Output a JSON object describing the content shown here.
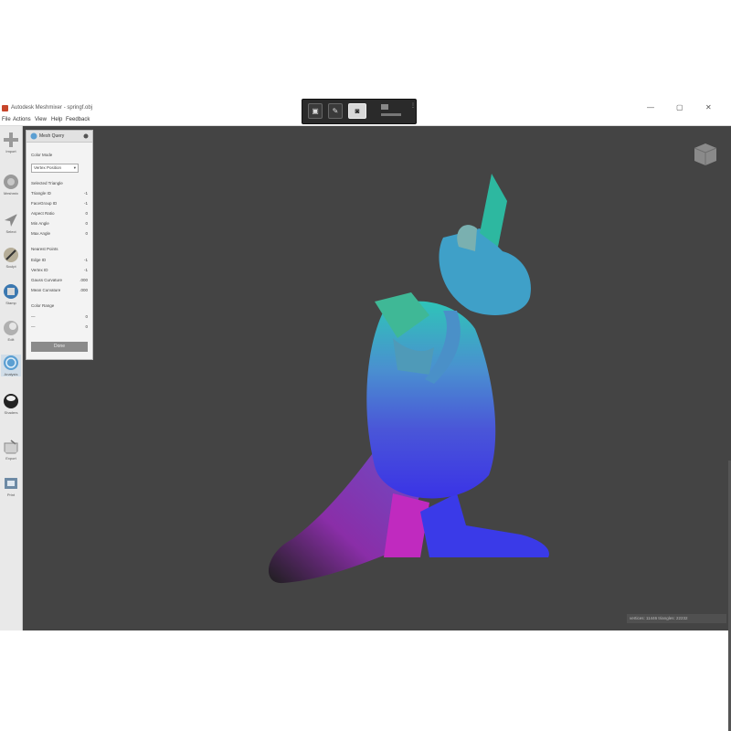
{
  "window": {
    "title": "Autodesk Meshmixer - springf.obj",
    "minimize_glyph": "—",
    "restore_glyph": "▢",
    "close_glyph": "✕"
  },
  "menu": [
    "File",
    "Actions",
    "View",
    "Help",
    "Feedback"
  ],
  "floating_bar": {
    "buttons": [
      {
        "icon": "monitor-icon",
        "glyph": "▣"
      },
      {
        "icon": "pen-icon",
        "glyph": "✎"
      },
      {
        "icon": "camera-icon",
        "glyph": "◙",
        "active": true
      }
    ]
  },
  "toolbar": {
    "tools": [
      {
        "label": "Import",
        "icon": "import-icon",
        "color": "#9a9a9a"
      },
      {
        "label": "Meshmix",
        "icon": "meshmix-icon",
        "color": "#7a7a7a"
      },
      {
        "label": "Select",
        "icon": "select-icon",
        "color": "#8a8a8a"
      },
      {
        "label": "Sculpt",
        "icon": "sculpt-icon",
        "color": "#8f8a7a"
      },
      {
        "label": "Stamp",
        "icon": "stamp-icon",
        "color": "#3b78b0"
      },
      {
        "label": "Edit",
        "icon": "edit-icon",
        "color": "#8c8c8c"
      },
      {
        "label": "Analysis",
        "icon": "analysis-icon",
        "color": "#5b9fd2",
        "active": true
      },
      {
        "label": "Shaders",
        "icon": "shaders-icon",
        "color": "#222222"
      },
      {
        "label": "Export",
        "icon": "export-icon",
        "color": "#8a8a8a"
      },
      {
        "label": "Print",
        "icon": "print-icon",
        "color": "#6d8aa5"
      }
    ]
  },
  "panel": {
    "title": "Mesh Query",
    "color_mode_label": "Color Mode",
    "color_mode_value": "Vertex Position",
    "selected_triangle_label": "Selected Triangle",
    "triangle_rows": [
      {
        "label": "Triangle ID",
        "value": "-1"
      },
      {
        "label": "FaceGroup ID",
        "value": "-1"
      },
      {
        "label": "Aspect Ratio",
        "value": "0"
      },
      {
        "label": "Min Angle",
        "value": "0"
      },
      {
        "label": "Max Angle",
        "value": "0"
      }
    ],
    "nearest_points_label": "Nearest Points",
    "nearest_rows": [
      {
        "label": "Edge ID",
        "value": "-1"
      },
      {
        "label": "Vertex ID",
        "value": "-1"
      },
      {
        "label": "Gauss Curvature",
        "value": ".000"
      },
      {
        "label": "Mean Curvature",
        "value": ".000"
      }
    ],
    "color_range_label": "Color Range",
    "range_rows": [
      {
        "label": "—",
        "value": "0"
      },
      {
        "label": "—",
        "value": "0"
      }
    ],
    "done_label": "Done"
  },
  "status_bar": "vertices: 11446 triangles: 22232",
  "colors": {
    "viewport": "#444444",
    "accent": "#5b9fd2"
  }
}
